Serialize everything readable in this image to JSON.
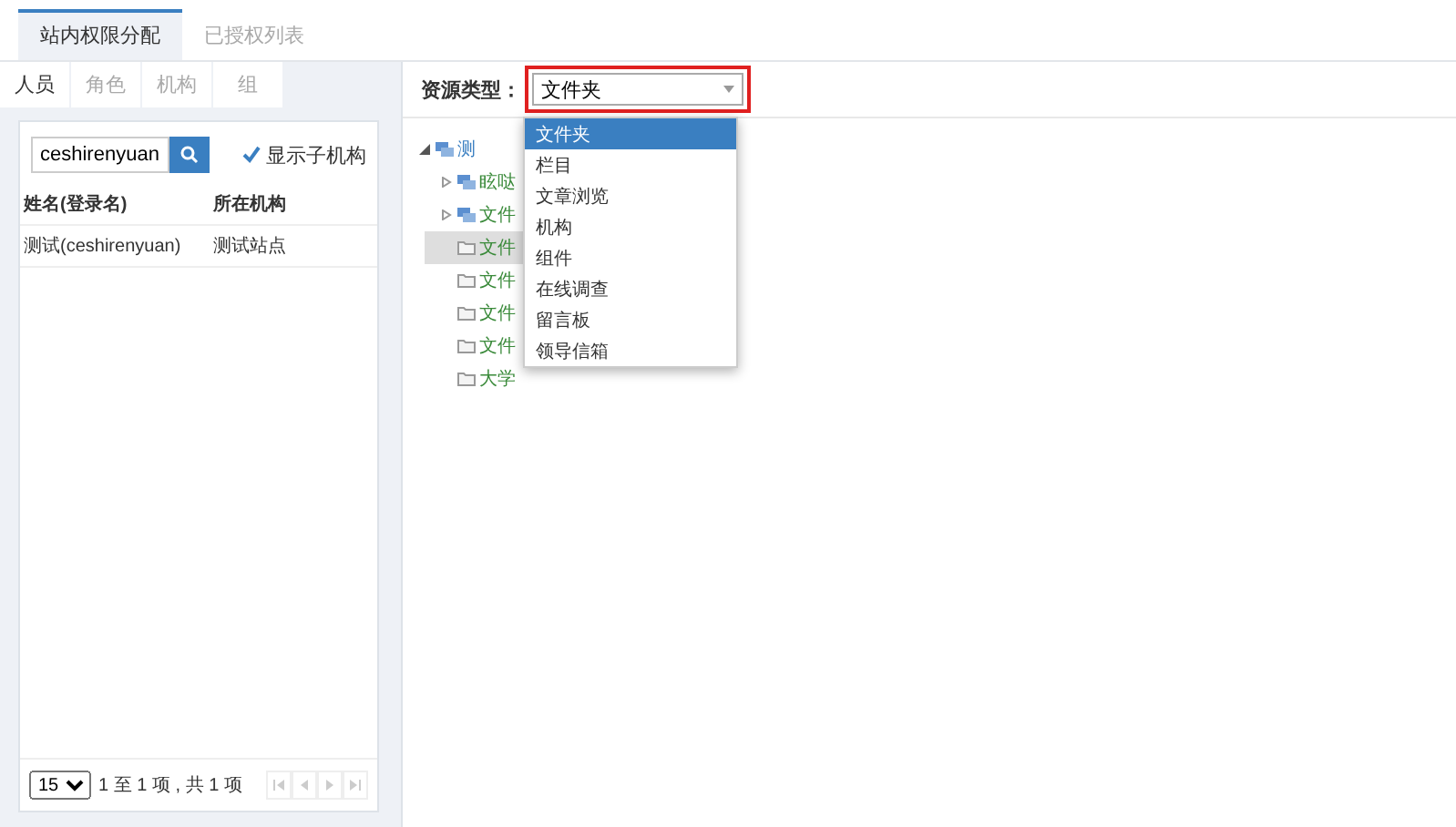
{
  "tabs": [
    {
      "label": "站内权限分配",
      "selected": true
    },
    {
      "label": "已授权列表",
      "selected": false
    }
  ],
  "left": {
    "tabs": [
      {
        "label": "人员",
        "selected": true
      },
      {
        "label": "角色",
        "selected": false
      },
      {
        "label": "机构",
        "selected": false
      },
      {
        "label": "组",
        "selected": false
      }
    ],
    "search": {
      "value": "ceshirenyuan"
    },
    "show_sub": {
      "label": "显示子机构",
      "checked": true
    },
    "table": {
      "columns": [
        "姓名(登录名)",
        "所在机构"
      ],
      "rows": [
        [
          "测试(ceshirenyuan)",
          "测试站点"
        ]
      ]
    },
    "pager": {
      "page_size": "15",
      "info": "1 至 1 项 , 共 1 项"
    }
  },
  "right": {
    "resource_label": "资源类型：",
    "select": {
      "value": "文件夹"
    },
    "options": [
      {
        "label": "文件夹",
        "selected": true
      },
      {
        "label": "栏目",
        "selected": false
      },
      {
        "label": "文章浏览",
        "selected": false
      },
      {
        "label": "机构",
        "selected": false
      },
      {
        "label": "组件",
        "selected": false
      },
      {
        "label": "在线调查",
        "selected": false
      },
      {
        "label": "留言板",
        "selected": false
      },
      {
        "label": "领导信箱",
        "selected": false
      }
    ],
    "tree": [
      {
        "label": "测",
        "expanded": true,
        "selected": false,
        "children": [
          {
            "label": "眩哒",
            "expanded": false,
            "selected": false
          },
          {
            "label": "文件",
            "expanded": false,
            "selected": false
          },
          {
            "label": "文件",
            "selected": true
          },
          {
            "label": "文件",
            "selected": false
          },
          {
            "label": "文件",
            "selected": false
          },
          {
            "label": "文件",
            "selected": false
          },
          {
            "label": "大学",
            "selected": false
          }
        ]
      }
    ]
  }
}
